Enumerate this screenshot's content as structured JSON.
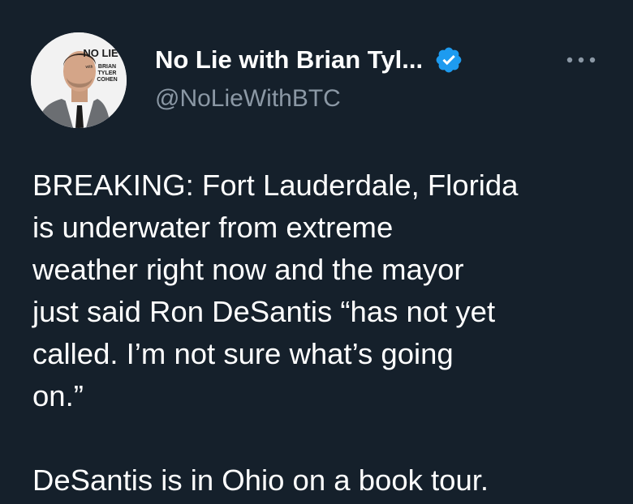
{
  "author": {
    "display_name": "No Lie with Brian Tyl...",
    "handle": "@NoLieWithBTC",
    "verified": true,
    "avatar_text": {
      "line1": "NO LIE",
      "with": "with",
      "name_lines": [
        "BRIAN",
        "TYLER",
        "COHEN"
      ]
    }
  },
  "menu": {
    "more_icon": "more-horizontal-icon"
  },
  "tweet": {
    "paragraphs": [
      "BREAKING: Fort Lauderdale, Florida\nis underwater from extreme\nweather right now and the mayor\njust said Ron DeSantis “has not yet\ncalled. I’m not sure what’s going\non.”",
      "DeSantis is in Ohio on a book tour."
    ]
  },
  "colors": {
    "background": "#15202b",
    "primary_text": "#ffffff",
    "secondary_text": "#8b98a5",
    "verified_badge": "#1d9bf0"
  }
}
